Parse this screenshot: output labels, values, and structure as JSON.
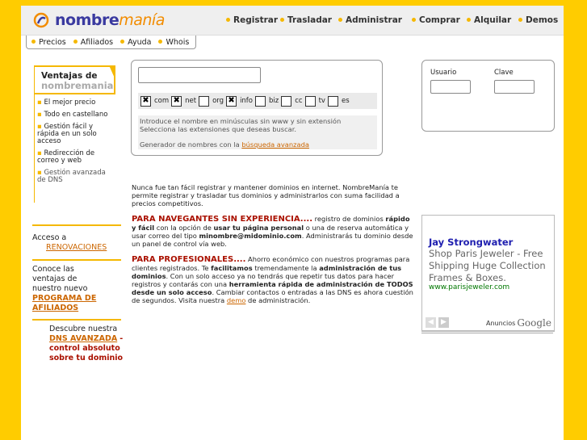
{
  "header": {
    "logo_text": "nombremanía",
    "nav": [
      "Registrar",
      "Trasladar",
      "Administrar",
      "Comprar",
      "Alquilar",
      "Demos"
    ],
    "subnav": [
      "Precios",
      "Afiliados",
      "Ayuda",
      "Whois"
    ]
  },
  "sidebar": {
    "benefits_title_1": "Ventajas de",
    "benefits_title_2": "nombremania",
    "benefits": [
      "El mejor precio",
      "Todo en castellano",
      "Gestión fácil y rápida en un solo acceso",
      "Redirección de correo y web",
      "Gestión avanzada de DNS"
    ],
    "access_prefix": "Acceso a",
    "access_link": "RENOVACIONES",
    "affiliate_text": "Conoce las ventajas de nuestro nuevo",
    "affiliate_link": "PROGRAMA DE AFILIADOS",
    "dns_prefix": "Descubre nuestra",
    "dns_link": "DNS AVANZADA",
    "dns_suffix": "- control absoluto sobre tu dominio"
  },
  "search": {
    "domain_value": "",
    "extensions": [
      {
        "label": "com",
        "checked": true
      },
      {
        "label": "net",
        "checked": true
      },
      {
        "label": "org",
        "checked": false
      },
      {
        "label": "info",
        "checked": true
      },
      {
        "label": "biz",
        "checked": false
      },
      {
        "label": "cc",
        "checked": false
      },
      {
        "label": "tv",
        "checked": false
      },
      {
        "label": "es",
        "checked": false
      }
    ],
    "hint_1": "Introduce el nombre en minúsculas sin www y sin extensión",
    "hint_2": "Selecciona las extensiones que deseas buscar.",
    "generator_prefix": "Generador de nombres con la",
    "generator_link": "búsqueda avanzada"
  },
  "login": {
    "user_label": "Usuario",
    "pass_label": "Clave",
    "user_value": "",
    "pass_value": ""
  },
  "content": {
    "intro": "Nunca fue tan fácil registrar y mantener dominios en internet. NombreManía te permite registrar y trasladar tus dominios y administrarlos con suma facilidad a precios competitivos.",
    "nav_heading": "PARA NAVEGANTES SIN EXPERIENCIA....",
    "nav_t1": " registro de dominios ",
    "nav_b1": "rápido y fácil",
    "nav_t2": " con la opción de ",
    "nav_b2": "usar tu página personal",
    "nav_t3": " o una de reserva automática y usar correo del tipo ",
    "nav_b3": "minombre@midominio.com",
    "nav_t4": ". Administrarás tu dominio desde un panel de control vía web.",
    "pro_heading": "PARA PROFESIONALES....",
    "pro_t1": " Ahorro económico con nuestros programas para clientes registrados. Te ",
    "pro_b1": "facilitamos",
    "pro_t2": " tremendamente la ",
    "pro_b2": "administración de tus dominios",
    "pro_t3": ". Con un solo acceso ya no tendrás que repetir tus datos para hacer registros y contarás con una ",
    "pro_b3": "herramienta rápida de administración de TODOS desde un solo acceso",
    "pro_t4": ". Cambiar contactos o entradas a las DNS es ahora cuestión de segundos. Visita nuestra ",
    "pro_link": "demo",
    "pro_t5": " de administración."
  },
  "ad": {
    "title": "Jay Strongwater",
    "description": "Shop Paris Jeweler - Free Shipping Huge Collection Frames & Boxes.",
    "url": "www.parisjeweler.com",
    "credit_prefix": "Anuncios",
    "credit_brand": "Google"
  },
  "colors": {
    "frame": "#ffcc00",
    "accent": "#f5b800",
    "brand_blue": "#3a3aa0",
    "link": "#cc6600",
    "heading_red": "#aa1100"
  }
}
